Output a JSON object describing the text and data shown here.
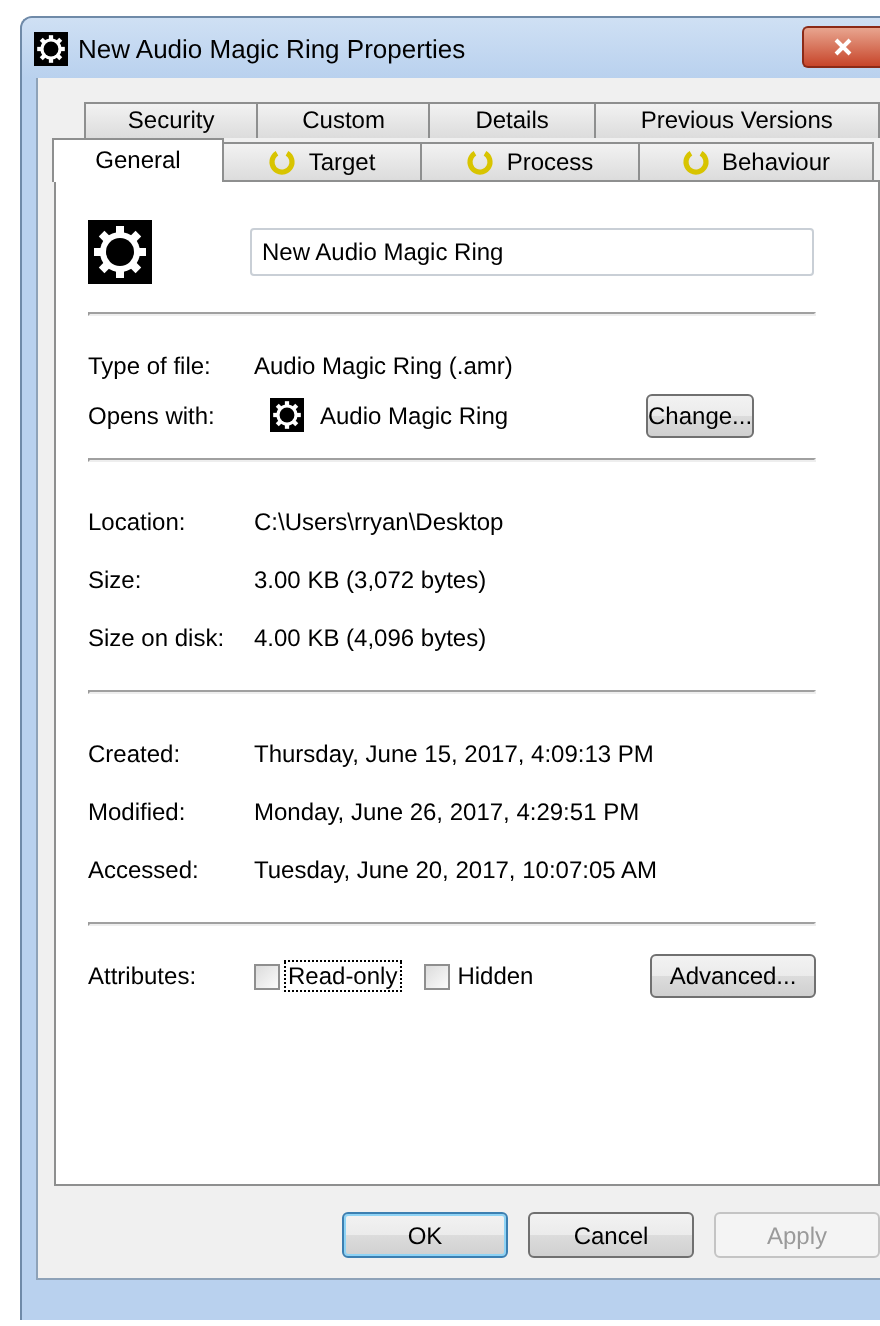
{
  "window": {
    "title": "New Audio Magic Ring Properties"
  },
  "tabs_back_row": [
    {
      "label": "Security",
      "selected": false,
      "has_icon": false
    },
    {
      "label": "Custom",
      "selected": false,
      "has_icon": false
    },
    {
      "label": "Details",
      "selected": false,
      "has_icon": false
    },
    {
      "label": "Previous Versions",
      "selected": false,
      "has_icon": false
    }
  ],
  "tabs_front_row": [
    {
      "label": "General",
      "selected": true,
      "has_icon": false
    },
    {
      "label": "Target",
      "selected": false,
      "has_icon": true
    },
    {
      "label": "Process",
      "selected": false,
      "has_icon": true
    },
    {
      "label": "Behaviour",
      "selected": false,
      "has_icon": true
    }
  ],
  "file_name": {
    "value": "New Audio Magic Ring"
  },
  "groups": [
    [
      {
        "label": "Type of file:",
        "value": "Audio Magic Ring (.amr)",
        "kind": "text"
      },
      {
        "label": "Opens with:",
        "value": "Audio Magic Ring",
        "kind": "app",
        "button": "Change..."
      }
    ],
    [
      {
        "label": "Location:",
        "value": "C:\\Users\\rryan\\Desktop",
        "kind": "text"
      },
      {
        "label": "Size:",
        "value": "3.00 KB (3,072 bytes)",
        "kind": "text"
      },
      {
        "label": "Size on disk:",
        "value": "4.00 KB (4,096 bytes)",
        "kind": "text"
      }
    ],
    [
      {
        "label": "Created:",
        "value": "Thursday, June 15, 2017, 4:09:13 PM",
        "kind": "text"
      },
      {
        "label": "Modified:",
        "value": "Monday, June 26, 2017, 4:29:51 PM",
        "kind": "text"
      },
      {
        "label": "Accessed:",
        "value": "Tuesday, June 20, 2017, 10:07:05 AM",
        "kind": "text"
      }
    ]
  ],
  "attributes": {
    "label": "Attributes:",
    "checkboxes": [
      {
        "label": "Read-only",
        "checked": false,
        "focused": true
      },
      {
        "label": "Hidden",
        "checked": false,
        "focused": false
      }
    ],
    "button": "Advanced..."
  },
  "buttons": [
    {
      "label": "OK",
      "default": true,
      "disabled": false
    },
    {
      "label": "Cancel",
      "default": false,
      "disabled": false
    },
    {
      "label": "Apply",
      "default": false,
      "disabled": true
    }
  ]
}
